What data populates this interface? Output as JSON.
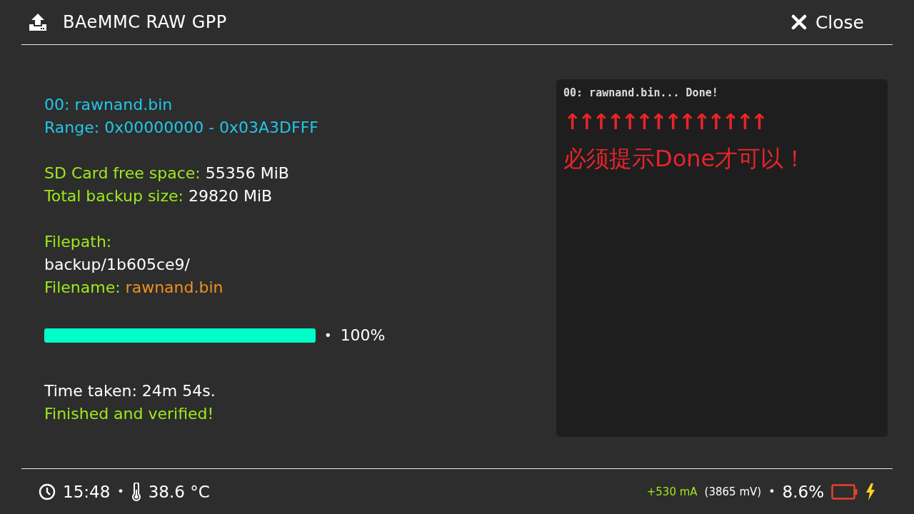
{
  "header": {
    "title": "BAeMMC RAW GPP",
    "close_label": "Close"
  },
  "info_groups": [
    [
      [
        {
          "kind": "info",
          "text": "00: rawnand.bin"
        }
      ],
      [
        {
          "kind": "info",
          "text": "Range: 0x00000000 - 0x03A3DFFF"
        }
      ]
    ],
    [
      [
        {
          "kind": "label",
          "text": "SD Card free space: "
        },
        {
          "kind": "value",
          "text": "55356 MiB"
        }
      ],
      [
        {
          "kind": "label",
          "text": "Total backup size: "
        },
        {
          "kind": "value",
          "text": "29820 MiB"
        }
      ]
    ],
    [
      [
        {
          "kind": "label",
          "text": "Filepath:"
        }
      ],
      [
        {
          "kind": "value",
          "text": "backup/1b605ce9/"
        }
      ],
      [
        {
          "kind": "label",
          "text": "Filename: "
        },
        {
          "kind": "file",
          "text": "rawnand.bin"
        }
      ]
    ]
  ],
  "progress": {
    "level": 1,
    "separator": "•",
    "reading": "100%"
  },
  "result": [
    {
      "kind": "value",
      "text": "Time taken: 24m 54s."
    },
    {
      "kind": "label",
      "text": "Finished and verified!"
    }
  ],
  "log": {
    "lines": [
      "00: rawnand.bin... Done!"
    ],
    "arrows": "↑↑↑↑↑↑↑↑↑↑↑↑↑↑",
    "note": "必须提示Done才可以！"
  },
  "footer": {
    "time": "15:48",
    "separator": "•",
    "temperature": "38.6 °C",
    "current": "+530 mA",
    "voltage": "(3865 mV)",
    "separator_2": "•",
    "battery": "8.6%",
    "charging": true
  }
}
